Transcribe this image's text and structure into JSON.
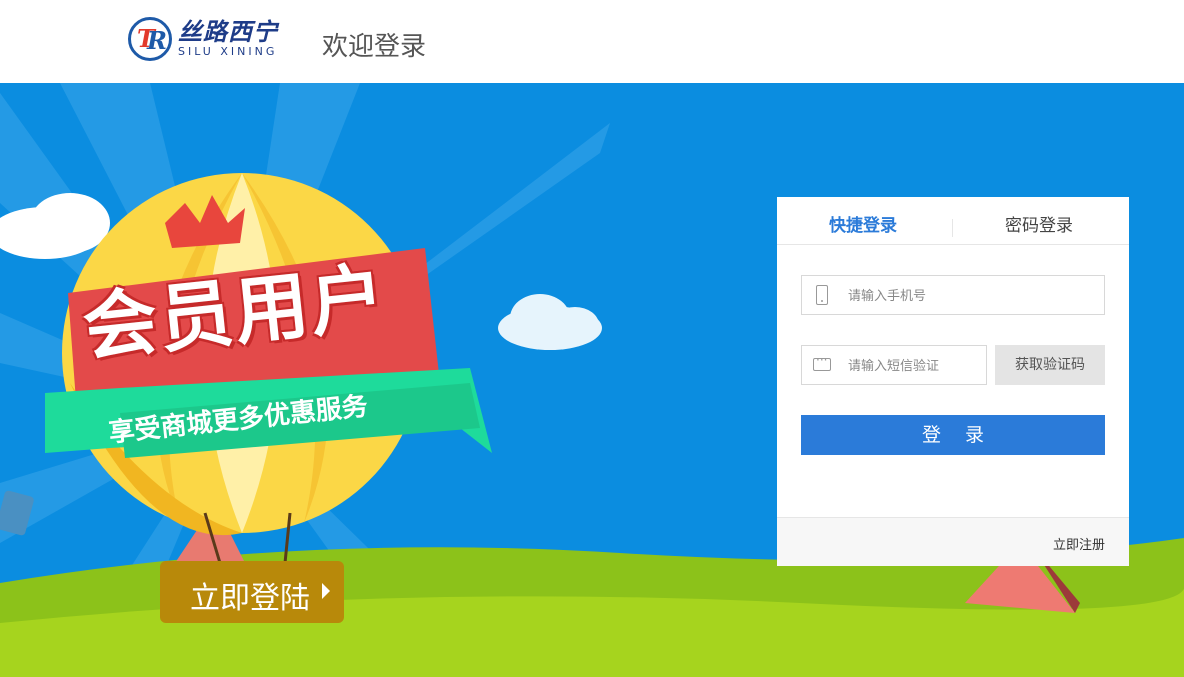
{
  "header": {
    "logo_cn": "丝路西宁",
    "logo_en": "SILU XINING",
    "welcome": "欢迎登录"
  },
  "banner": {
    "title": "会员用户",
    "ribbon": "享受商城更多优惠服务",
    "cta": "立即登陆"
  },
  "login": {
    "tab_quick": "快捷登录",
    "tab_password": "密码登录",
    "phone_placeholder": "请输入手机号",
    "sms_placeholder": "请输入短信验证",
    "get_code": "获取验证码",
    "submit": "登录",
    "register": "立即注册"
  },
  "colors": {
    "accent": "#2b7bd9",
    "banner_sky": "#0b8de0",
    "grass": "#8cc21a"
  }
}
